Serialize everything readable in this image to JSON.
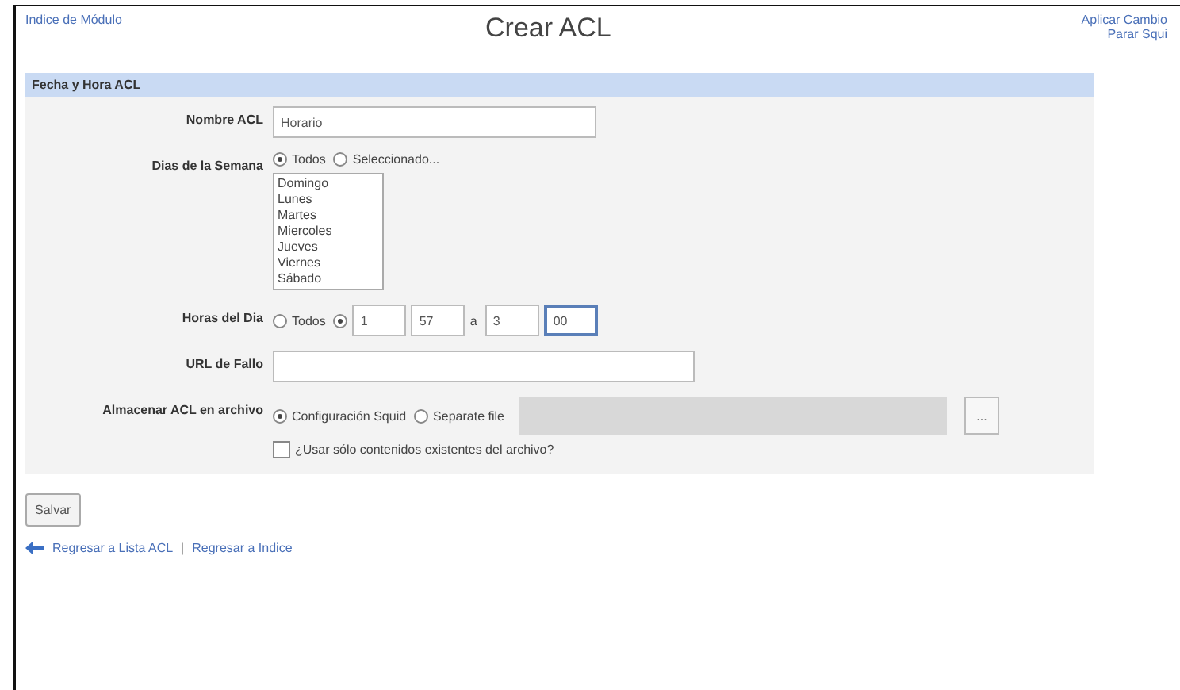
{
  "top_links": {
    "left": "Indice de Módulo",
    "right": [
      "Aplicar Cambio",
      "Parar Squi"
    ]
  },
  "title": "Crear ACL",
  "section": {
    "heading": "Fecha y Hora ACL"
  },
  "fields": [
    {
      "kind": "text",
      "label": "Nombre ACL",
      "value": "Horario",
      "focused": false
    },
    {
      "kind": "days",
      "label": "Dias de la Semana",
      "options": [
        {
          "label": "Todos",
          "selected": true
        },
        {
          "label": "Seleccionado...",
          "selected": false
        }
      ],
      "days": [
        "Domingo",
        "Lunes",
        "Martes",
        "Miercoles",
        "Jueves",
        "Viernes",
        "Sábado"
      ]
    },
    {
      "kind": "hours",
      "label": "Horas del Dia",
      "options": [
        {
          "label": "Todos",
          "selected": false
        },
        {
          "selected": true
        }
      ],
      "times": [
        {
          "value": "1",
          "focused": false
        },
        {
          "value": "57",
          "focused": false
        },
        {
          "value": "3",
          "focused": false
        },
        {
          "value": "00",
          "focused": true
        }
      ],
      "separator": "a"
    },
    {
      "kind": "text",
      "label": "URL de Fallo",
      "focused": false
    },
    {
      "kind": "store",
      "label": "Almacenar ACL en archivo",
      "options": [
        {
          "label": "Configuración Squid",
          "selected": true
        },
        {
          "label": "Separate file",
          "selected": false
        }
      ],
      "browse": "...",
      "checkbox": {
        "label": "¿Usar sólo contenidos existentes del archivo?",
        "checked": false
      }
    }
  ],
  "save_button": "Salvar",
  "bottom_links": [
    "Regresar a Lista ACL",
    "Regresar a Indice"
  ],
  "link_separator": "|"
}
